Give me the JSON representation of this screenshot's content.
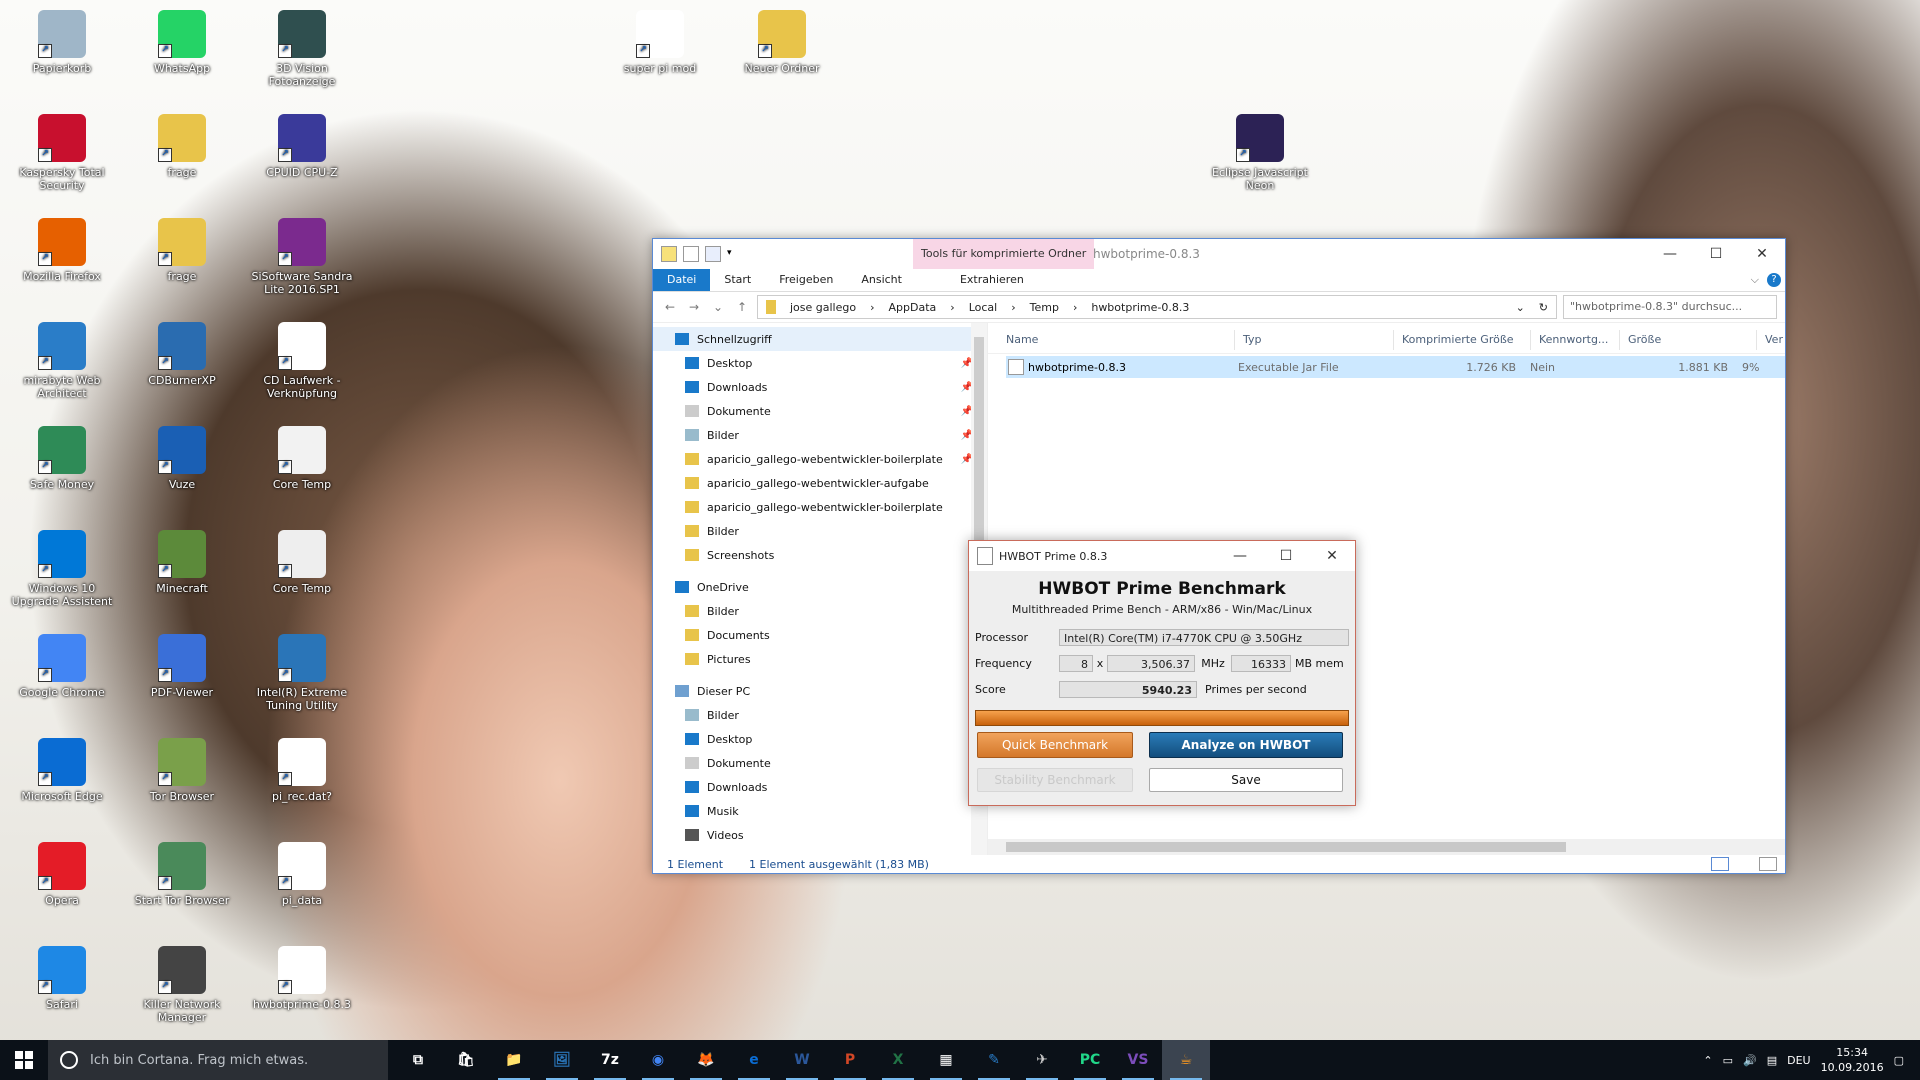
{
  "desktop": {
    "icons": [
      {
        "label": "Papierkorb",
        "icon": "recycle-bin-icon"
      },
      {
        "label": "WhatsApp",
        "icon": "whatsapp-icon"
      },
      {
        "label": "3D Vision Fotoanzeige",
        "icon": "3d-vision-icon"
      },
      {
        "label": "super pi mod",
        "icon": "super-pi-icon"
      },
      {
        "label": "Neuer Ordner",
        "icon": "folder-icon"
      },
      {
        "label": "Kaspersky Total Security",
        "icon": "kaspersky-icon"
      },
      {
        "label": "frage",
        "icon": "zip-folder-icon"
      },
      {
        "label": "CPUID CPU-Z",
        "icon": "cpu-z-icon"
      },
      {
        "label": "Eclipse Javascript Neon",
        "icon": "eclipse-icon"
      },
      {
        "label": "Mozilla Firefox",
        "icon": "firefox-icon"
      },
      {
        "label": "frage",
        "icon": "file-icon"
      },
      {
        "label": "SiSoftware Sandra Lite 2016.SP1",
        "icon": "sandra-icon"
      },
      {
        "label": "mirabyte Web Architect",
        "icon": "web-architect-icon"
      },
      {
        "label": "CDBurnerXP",
        "icon": "cdburner-icon"
      },
      {
        "label": "CD Laufwerk - Verknüpfung",
        "icon": "asr-icon"
      },
      {
        "label": "Safe Money",
        "icon": "safe-money-icon"
      },
      {
        "label": "Vuze",
        "icon": "vuze-icon"
      },
      {
        "label": "Core Temp",
        "icon": "thermometer-icon"
      },
      {
        "label": "Windows 10 Upgrade Assistent",
        "icon": "windows-icon"
      },
      {
        "label": "Minecraft",
        "icon": "minecraft-icon"
      },
      {
        "label": "Core Temp",
        "icon": "settings-file-icon"
      },
      {
        "label": "Google Chrome",
        "icon": "chrome-icon"
      },
      {
        "label": "PDF-Viewer",
        "icon": "pdf-icon"
      },
      {
        "label": "Intel(R) Extreme Tuning Utility",
        "icon": "intel-xtu-icon"
      },
      {
        "label": "Microsoft Edge",
        "icon": "edge-icon"
      },
      {
        "label": "Tor Browser",
        "icon": "tor-folder-icon"
      },
      {
        "label": "pi_rec.dat?",
        "icon": "blank-file-icon"
      },
      {
        "label": "Opera",
        "icon": "opera-icon"
      },
      {
        "label": "Start Tor Browser",
        "icon": "tor-globe-icon"
      },
      {
        "label": "pi_data",
        "icon": "text-file-icon"
      },
      {
        "label": "Safari",
        "icon": "safari-icon"
      },
      {
        "label": "Killer Network Manager",
        "icon": "killer-icon"
      },
      {
        "label": "hwbotprime-0.8.3",
        "icon": "java-icon"
      }
    ]
  },
  "explorer": {
    "context_tab": "Tools für komprimierte Ordner",
    "title": "hwbotprime-0.8.3",
    "ribbon_tabs": [
      "Datei",
      "Start",
      "Freigeben",
      "Ansicht",
      "Extrahieren"
    ],
    "path": [
      "jose gallego",
      "AppData",
      "Local",
      "Temp",
      "hwbotprime-0.8.3"
    ],
    "search_placeholder": "\"hwbotprime-0.8.3\" durchsuc...",
    "nav": [
      {
        "label": "Schnellzugriff",
        "icon": "star-icon",
        "header": true
      },
      {
        "label": "Desktop",
        "icon": "desktop-icon",
        "pinned": true
      },
      {
        "label": "Downloads",
        "icon": "download-icon",
        "pinned": true
      },
      {
        "label": "Dokumente",
        "icon": "document-icon",
        "pinned": true
      },
      {
        "label": "Bilder",
        "icon": "pictures-icon",
        "pinned": true
      },
      {
        "label": "aparicio_gallego-webentwickler-boilerplate",
        "icon": "folder-icon",
        "pinned": true
      },
      {
        "label": "aparicio_gallego-webentwickler-aufgabe",
        "icon": "folder-icon"
      },
      {
        "label": "aparicio_gallego-webentwickler-boilerplate",
        "icon": "folder-icon"
      },
      {
        "label": "Bilder",
        "icon": "synced-folder-icon"
      },
      {
        "label": "Screenshots",
        "icon": "synced-folder-icon"
      },
      {
        "label": "OneDrive",
        "icon": "cloud-icon",
        "header": true
      },
      {
        "label": "Bilder",
        "icon": "synced-folder-icon"
      },
      {
        "label": "Documents",
        "icon": "synced-folder-icon"
      },
      {
        "label": "Pictures",
        "icon": "synced-folder-icon"
      },
      {
        "label": "Dieser PC",
        "icon": "computer-icon",
        "header": true
      },
      {
        "label": "Bilder",
        "icon": "pictures-icon"
      },
      {
        "label": "Desktop",
        "icon": "desktop-icon"
      },
      {
        "label": "Dokumente",
        "icon": "document-icon"
      },
      {
        "label": "Downloads",
        "icon": "download-icon"
      },
      {
        "label": "Musik",
        "icon": "music-icon"
      },
      {
        "label": "Videos",
        "icon": "video-icon"
      }
    ],
    "columns": [
      "Name",
      "Typ",
      "Komprimierte Größe",
      "Kennwortg...",
      "Größe",
      "Ver"
    ],
    "files": [
      {
        "name": "hwbotprime-0.8.3",
        "type": "Executable Jar File",
        "compressed": "1.726 KB",
        "password": "Nein",
        "size": "1.881 KB",
        "ratio": "9%"
      }
    ],
    "status_count": "1 Element",
    "status_selected": "1 Element ausgewählt (1,83 MB)"
  },
  "hwbot": {
    "title": "HWBOT Prime 0.8.3",
    "heading": "HWBOT Prime Benchmark",
    "subtitle": "Multithreaded Prime Bench - ARM/x86 - Win/Mac/Linux",
    "processor_label": "Processor",
    "processor": "Intel(R) Core(TM) i7-4770K CPU @ 3.50GHz",
    "frequency_label": "Frequency",
    "threads": "8",
    "x": "x",
    "frequency": "3,506.37",
    "mhz": "MHz",
    "memory": "16333",
    "mem_unit": "MB mem",
    "score_label": "Score",
    "score": "5940.23",
    "score_unit": "Primes per second",
    "progress": 1.0,
    "quick_benchmark": "Quick Benchmark",
    "analyze": "Analyze on HWBOT",
    "stability": "Stability Benchmark",
    "save": "Save"
  },
  "taskbar": {
    "cortana_placeholder": "Ich bin Cortana. Frag mich etwas.",
    "apps": [
      {
        "label": "⧉",
        "icon": "task-view-icon"
      },
      {
        "label": "🛍",
        "icon": "store-icon"
      },
      {
        "label": "📁",
        "icon": "file-explorer-icon"
      },
      {
        "label": "🖼",
        "icon": "photos-icon"
      },
      {
        "label": "7z",
        "icon": "7zip-icon"
      },
      {
        "label": "◉",
        "icon": "chrome-icon"
      },
      {
        "label": "🦊",
        "icon": "firefox-icon"
      },
      {
        "label": "e",
        "icon": "edge-icon"
      },
      {
        "label": "W",
        "icon": "word-icon"
      },
      {
        "label": "P",
        "icon": "powerpoint-icon"
      },
      {
        "label": "X",
        "icon": "excel-icon"
      },
      {
        "label": "▦",
        "icon": "calculator-icon"
      },
      {
        "label": "✎",
        "icon": "web-architect-icon"
      },
      {
        "label": "✈",
        "icon": "game-icon"
      },
      {
        "label": "PC",
        "icon": "pycharm-icon"
      },
      {
        "label": "VS",
        "icon": "visual-studio-icon"
      },
      {
        "label": "☕",
        "icon": "java-icon"
      }
    ],
    "language": "DEU",
    "time": "15:34",
    "date": "10.09.2016"
  },
  "colors": {
    "accent": "#1979ca",
    "hwbot_orange": "#d4782b",
    "hwbot_blue": "#134d7d",
    "taskbar": "#0b1118"
  }
}
